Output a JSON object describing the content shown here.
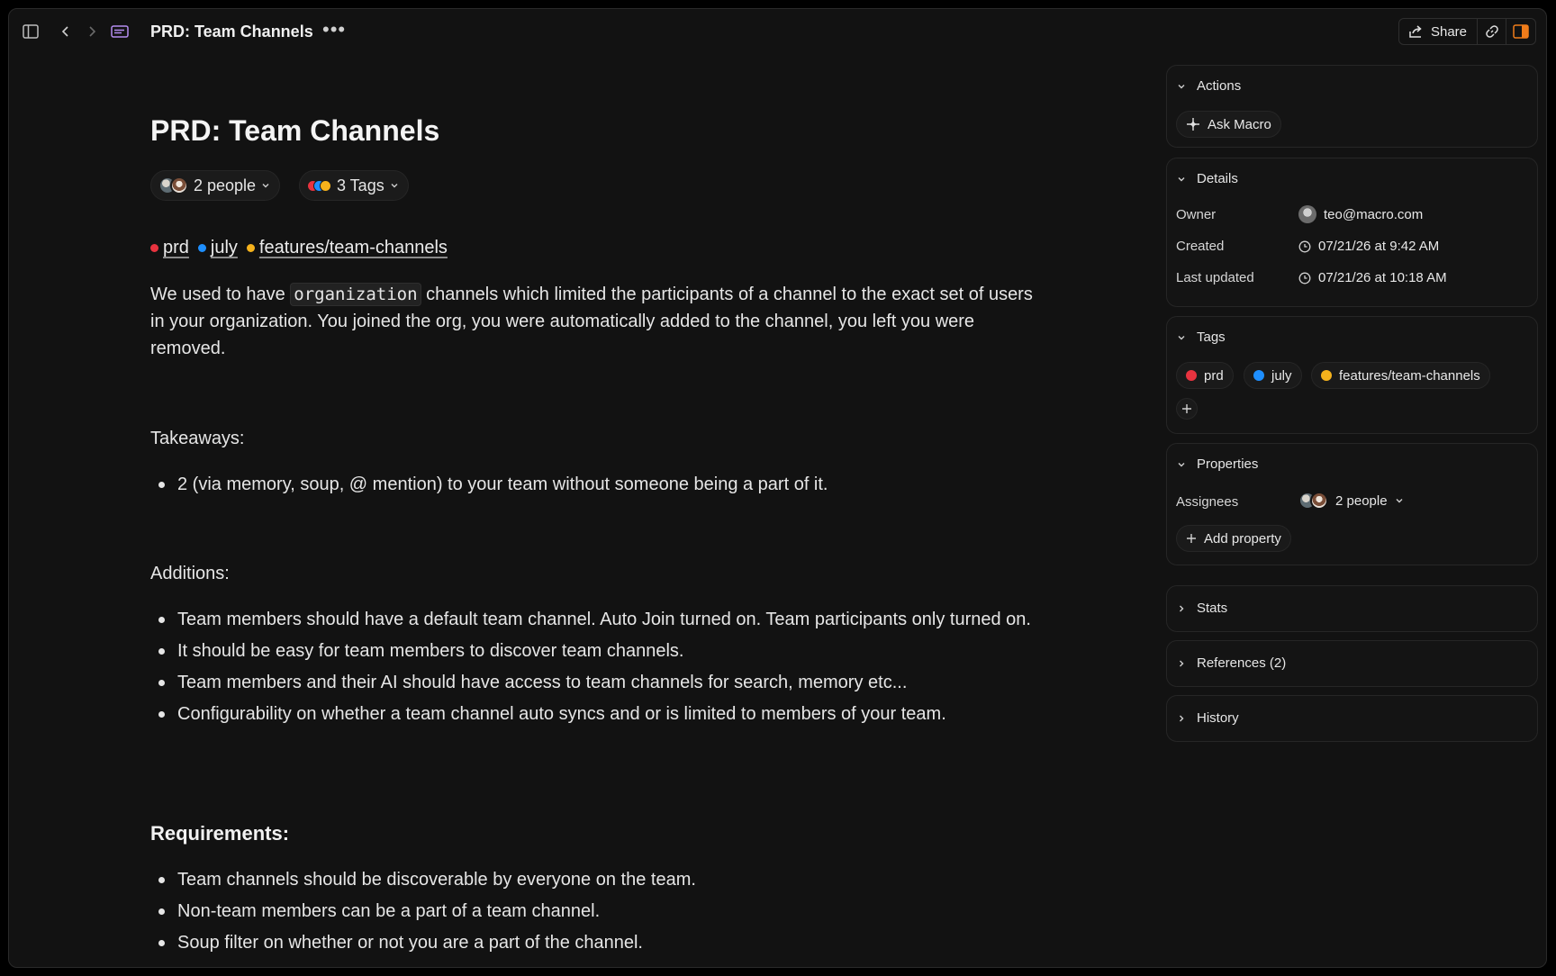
{
  "topbar": {
    "title": "PRD: Team Channels",
    "more": "•••",
    "share_label": "Share"
  },
  "doc": {
    "title": "PRD: Team Channels",
    "people_chip": "2 people",
    "tags_chip": "3 Tags",
    "tags": [
      {
        "label": "prd",
        "color": "#e8333f"
      },
      {
        "label": "july",
        "color": "#1e8fff"
      },
      {
        "label": "features/team-channels",
        "color": "#f5b21c"
      }
    ],
    "intro_before_code": "We used to have ",
    "intro_code": "organization",
    "intro_after_code": " channels which limited the participants of a channel to the exact set of users in your organization. You joined the org, you were automatically added to the channel, you left you were removed.",
    "takeaways_label": "Takeaways:",
    "takeaways": [
      "2 (via memory, soup, @ mention) to your team without someone being a part of it."
    ],
    "additions_label": "Additions:",
    "additions": [
      "Team members should have a default team channel. Auto Join turned on. Team participants only turned on.",
      "It should be easy for team members to discover team channels.",
      "Team members and their AI should have access to team channels for search, memory etc...",
      "Configurability on whether a team channel auto syncs and or is limited to members of your team."
    ],
    "requirements_label": "Requirements:",
    "requirements": [
      "Team channels should be discoverable by everyone on the team.",
      "Non-team members can be a part of a team channel.",
      "Soup filter on whether or not you are a part of the channel."
    ]
  },
  "sidebar": {
    "actions": {
      "title": "Actions",
      "ask_macro": "Ask Macro"
    },
    "details": {
      "title": "Details",
      "owner_label": "Owner",
      "owner_value": "teo@macro.com",
      "created_label": "Created",
      "created_value": "07/21/26 at 9:42 AM",
      "updated_label": "Last updated",
      "updated_value": "07/21/26 at 10:18 AM"
    },
    "tags": {
      "title": "Tags",
      "items": [
        {
          "label": "prd",
          "color": "#e8333f"
        },
        {
          "label": "july",
          "color": "#1e8fff"
        },
        {
          "label": "features/team-channels",
          "color": "#f5b21c"
        }
      ]
    },
    "properties": {
      "title": "Properties",
      "assignees_label": "Assignees",
      "assignees_value": "2 people",
      "add_property": "Add property"
    },
    "stats": {
      "title": "Stats"
    },
    "references": {
      "title": "References (2)"
    },
    "history": {
      "title": "History"
    }
  },
  "colors": {
    "accent_orange": "#f07c1a",
    "background": "#121212"
  }
}
